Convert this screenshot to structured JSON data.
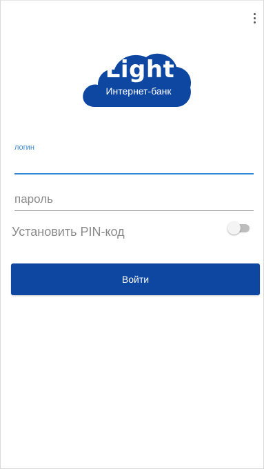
{
  "app": {
    "logo_title": "Light",
    "logo_subtitle": "Интернет-банк",
    "brand_color": "#0D47A1"
  },
  "toolbar": {
    "menu_icon": "more-vert-icon"
  },
  "login_field": {
    "label": "логин",
    "value": "",
    "accent_color": "#2F86D2"
  },
  "password_field": {
    "placeholder": "пароль",
    "value": ""
  },
  "pin": {
    "label": "Установить PIN-код",
    "enabled": false
  },
  "submit": {
    "label": "Войти"
  }
}
